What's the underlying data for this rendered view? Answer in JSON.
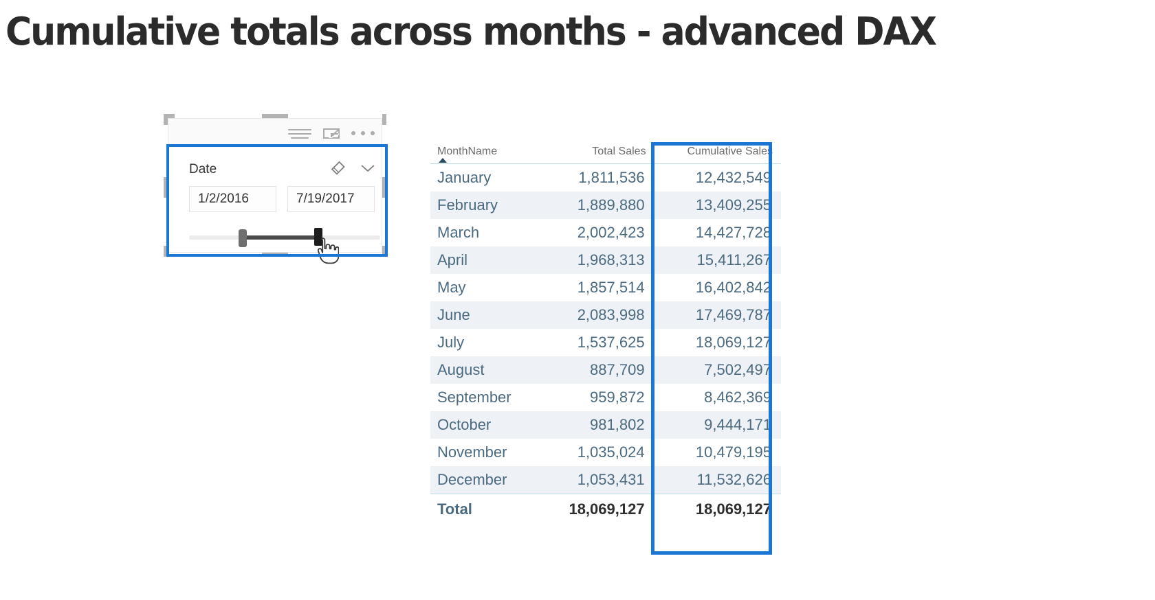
{
  "page": {
    "title": "Cumulative totals across months - advanced DAX",
    "background": "#ffffff",
    "accent_blue": "#1a76d2"
  },
  "slicer": {
    "field_label": "Date",
    "start_value": "1/2/2016",
    "end_value": "7/19/2017",
    "header_icons": [
      {
        "name": "filter-icon",
        "glyph": "lines"
      },
      {
        "name": "focus-mode-icon",
        "glyph": "expand-arrow"
      },
      {
        "name": "more-options-icon",
        "glyph": "ellipsis"
      }
    ],
    "title_icons": [
      {
        "name": "clear-filter-icon",
        "glyph": "eraser"
      },
      {
        "name": "chevron-down-icon",
        "glyph": "chevron"
      }
    ],
    "slider": {
      "left_handle_pct": 26,
      "right_handle_pct": 66
    },
    "cursor": "hand-pointer"
  },
  "table": {
    "columns": [
      {
        "key": "month",
        "label": "MonthName",
        "sorted": "ascending"
      },
      {
        "key": "total",
        "label": "Total Sales"
      },
      {
        "key": "cumulative",
        "label": "Cumulative Sales",
        "highlighted": true
      }
    ],
    "rows": [
      {
        "month": "January",
        "total": "1,811,536",
        "cumulative": "12,432,549"
      },
      {
        "month": "February",
        "total": "1,889,880",
        "cumulative": "13,409,255"
      },
      {
        "month": "March",
        "total": "2,002,423",
        "cumulative": "14,427,728"
      },
      {
        "month": "April",
        "total": "1,968,313",
        "cumulative": "15,411,267"
      },
      {
        "month": "May",
        "total": "1,857,514",
        "cumulative": "16,402,842"
      },
      {
        "month": "June",
        "total": "2,083,998",
        "cumulative": "17,469,787"
      },
      {
        "month": "July",
        "total": "1,537,625",
        "cumulative": "18,069,127"
      },
      {
        "month": "August",
        "total": "887,709",
        "cumulative": "7,502,497"
      },
      {
        "month": "September",
        "total": "959,872",
        "cumulative": "8,462,369"
      },
      {
        "month": "October",
        "total": "981,802",
        "cumulative": "9,444,171"
      },
      {
        "month": "November",
        "total": "1,035,024",
        "cumulative": "10,479,195"
      },
      {
        "month": "December",
        "total": "1,053,431",
        "cumulative": "11,532,626"
      }
    ],
    "total_row": {
      "label": "Total",
      "total": "18,069,127",
      "cumulative": "18,069,127"
    }
  },
  "chart_data": {
    "type": "table",
    "title": "Cumulative totals across months - advanced DAX",
    "categories": [
      "January",
      "February",
      "March",
      "April",
      "May",
      "June",
      "July",
      "August",
      "September",
      "October",
      "November",
      "December"
    ],
    "series": [
      {
        "name": "Total Sales",
        "values": [
          1811536,
          1889880,
          2002423,
          1968313,
          1857514,
          2083998,
          1537625,
          887709,
          959872,
          981802,
          1035024,
          1053431
        ],
        "total": 18069127
      },
      {
        "name": "Cumulative Sales",
        "values": [
          12432549,
          13409255,
          14427728,
          15411267,
          16402842,
          17469787,
          18069127,
          7502497,
          8462369,
          9444171,
          10479195,
          11532626
        ],
        "total": 18069127
      }
    ],
    "xlabel": "MonthName",
    "ylabel": "",
    "legend": [
      "MonthName",
      "Total Sales",
      "Cumulative Sales"
    ],
    "annotations": [
      "Cumulative Sales column highlighted",
      "Date slicer filtered 1/2/2016 - 7/19/2017"
    ]
  }
}
